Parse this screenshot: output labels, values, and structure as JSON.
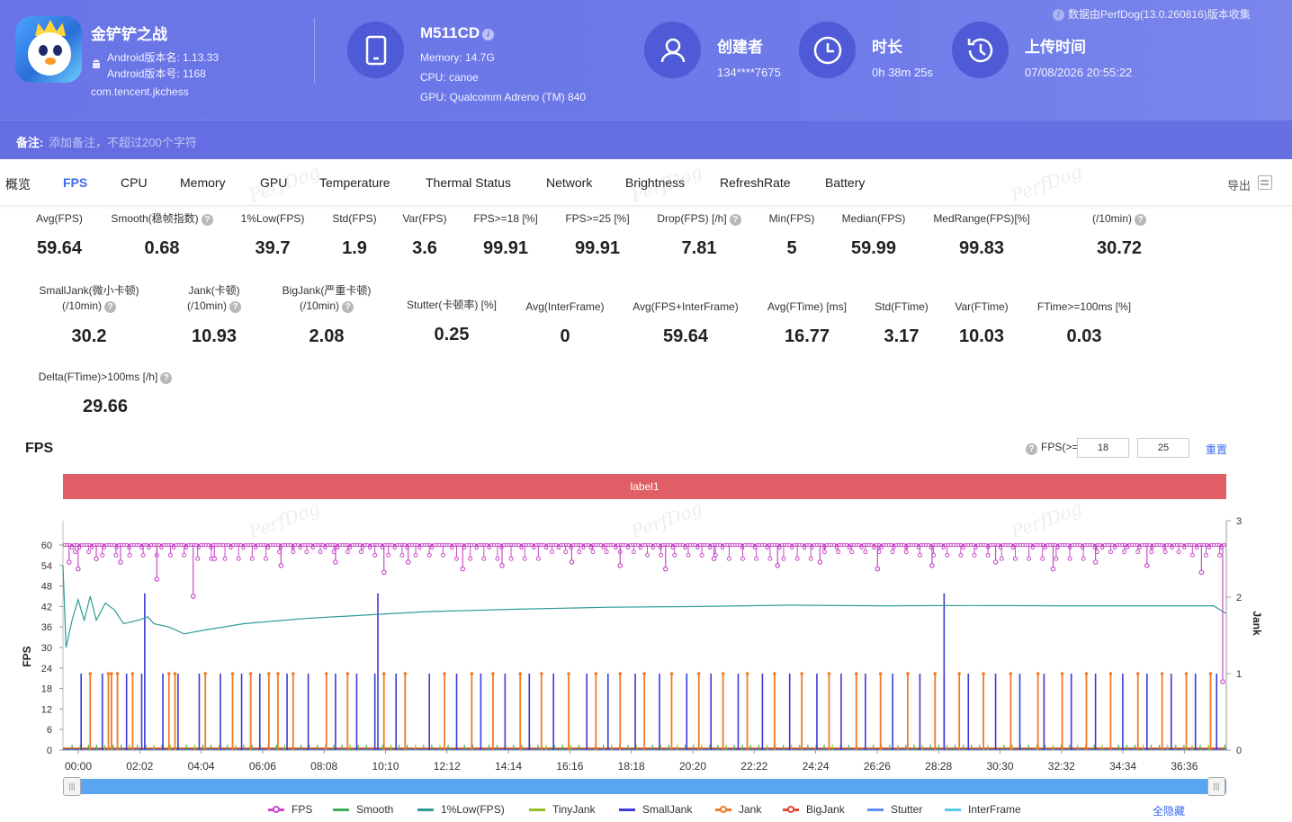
{
  "app": {
    "name": "金铲铲之战",
    "version_name": "Android版本名: 1.13.33",
    "version_code": "Android版本号: 1168",
    "package": "com.tencent.jkchess"
  },
  "device": {
    "model": "M511CD",
    "memory": "Memory: 14.7G",
    "cpu": "CPU: canoe",
    "gpu": "GPU: Qualcomm Adreno (TM) 840"
  },
  "creator": {
    "title": "创建者",
    "value": "134****7675"
  },
  "duration": {
    "title": "时长",
    "value": "0h 38m 25s"
  },
  "upload": {
    "title": "上传时间",
    "value": "07/08/2026 20:55:22"
  },
  "source_note": "数据由PerfDog(13.0.260816)版本收集",
  "remark": {
    "label": "备注:",
    "placeholder": "添加备注，不超过200个字符"
  },
  "tabs": [
    "概览",
    "FPS",
    "CPU",
    "Memory",
    "GPU",
    "Temperature",
    "Thermal Status",
    "Network",
    "Brightness",
    "RefreshRate",
    "Battery"
  ],
  "active_tab": "FPS",
  "export_label": "导出",
  "watermark": "PerfDog",
  "metrics_row1": [
    {
      "label": "Avg(FPS)",
      "value": "59.64"
    },
    {
      "label": "Smooth(稳帧指数)",
      "value": "0.68"
    },
    {
      "label": "1%Low(FPS)",
      "value": "39.7"
    },
    {
      "label": "Std(FPS)",
      "value": "1.9"
    },
    {
      "label": "Var(FPS)",
      "value": "3.6"
    },
    {
      "label": "FPS>=18 [%]",
      "value": "99.91"
    },
    {
      "label": "FPS>=25 [%]",
      "value": "99.91"
    },
    {
      "label": "Drop(FPS) [/h]",
      "value": "7.81"
    },
    {
      "label": "Min(FPS)",
      "value": "5"
    },
    {
      "label": "Median(FPS)",
      "value": "59.99"
    },
    {
      "label": "MedRange(FPS)[%]",
      "value": "99.83"
    },
    {
      "label": "(/10min)",
      "value": "30.72"
    }
  ],
  "metrics_row2": [
    {
      "label1": "SmallJank(微小卡顿)",
      "label2": "(/10min)",
      "value": "30.2"
    },
    {
      "label1": "Jank(卡顿)",
      "label2": "(/10min)",
      "value": "10.93"
    },
    {
      "label1": "BigJank(严重卡顿)",
      "label2": "(/10min)",
      "value": "2.08"
    },
    {
      "label1": "Stutter(卡顿率) [%]",
      "value": "0.25"
    },
    {
      "label1": "Avg(InterFrame)",
      "value": "0"
    },
    {
      "label1": "Avg(FPS+InterFrame)",
      "value": "59.64"
    },
    {
      "label1": "Avg(FTime) [ms]",
      "value": "16.77"
    },
    {
      "label1": "Std(FTime)",
      "value": "3.17"
    },
    {
      "label1": "Var(FTime)",
      "value": "10.03"
    },
    {
      "label1": "FTime>=100ms [%]",
      "value": "0.03"
    }
  ],
  "metrics_row3": [
    {
      "label": "Delta(FTime)>100ms [/h]",
      "value": "29.66"
    }
  ],
  "chart_controls": {
    "title": "FPS",
    "threshold_label": "FPS(>=)",
    "threshold1": "18",
    "threshold2": "25",
    "reset_label": "重置",
    "band_label": "label1",
    "hide_all_label": "全隐藏"
  },
  "chart_data": {
    "type": "line",
    "title": "FPS",
    "ylabel": "FPS",
    "y2label": "Jank",
    "ylim": [
      0,
      60
    ],
    "y2lim": [
      0,
      3
    ],
    "yticks": [
      "0",
      "6",
      "12",
      "18",
      "24",
      "30",
      "36",
      "42",
      "48",
      "54",
      "60"
    ],
    "y2ticks": [
      "0",
      "1",
      "2",
      "3"
    ],
    "xticks": [
      "00:00",
      "02:02",
      "04:04",
      "06:06",
      "08:08",
      "10:10",
      "12:12",
      "14:14",
      "16:16",
      "18:18",
      "20:20",
      "22:22",
      "24:24",
      "26:26",
      "28:28",
      "30:30",
      "32:32",
      "34:34",
      "36:36"
    ],
    "x_range_minutes": [
      0,
      38.42
    ],
    "series": [
      {
        "name": "FPS",
        "color": "#c94bc9",
        "baseline": 60,
        "dips": [
          [
            0.2,
            55
          ],
          [
            0.5,
            53
          ],
          [
            1.1,
            56
          ],
          [
            1.9,
            55
          ],
          [
            3.1,
            50
          ],
          [
            4.3,
            45
          ],
          [
            5.0,
            56
          ],
          [
            7.2,
            54
          ],
          [
            9.0,
            55
          ],
          [
            10.6,
            52
          ],
          [
            11.4,
            55
          ],
          [
            13.2,
            53
          ],
          [
            14.5,
            54
          ],
          [
            16.8,
            55
          ],
          [
            18.4,
            54
          ],
          [
            19.9,
            53
          ],
          [
            21.5,
            56
          ],
          [
            23.6,
            54
          ],
          [
            25.0,
            55
          ],
          [
            26.9,
            53
          ],
          [
            28.7,
            54
          ],
          [
            30.8,
            55
          ],
          [
            32.7,
            53
          ],
          [
            34.1,
            55
          ],
          [
            35.8,
            54
          ],
          [
            37.6,
            52
          ],
          [
            38.3,
            20
          ]
        ]
      },
      {
        "name": "Smooth",
        "color": "#3fae5a"
      },
      {
        "name": "1%Low(FPS)",
        "color": "#2e9b96",
        "points": [
          [
            0,
            54
          ],
          [
            0.1,
            30
          ],
          [
            0.3,
            38
          ],
          [
            0.5,
            44
          ],
          [
            0.7,
            38
          ],
          [
            0.9,
            45
          ],
          [
            1.1,
            38
          ],
          [
            1.4,
            43
          ],
          [
            1.7,
            41
          ],
          [
            2.0,
            37
          ],
          [
            2.5,
            38
          ],
          [
            2.8,
            39
          ],
          [
            3.0,
            37
          ],
          [
            3.5,
            36
          ],
          [
            4.0,
            34
          ],
          [
            4.6,
            35
          ],
          [
            6.0,
            37
          ],
          [
            8.0,
            38.5
          ],
          [
            10.0,
            39.5
          ],
          [
            12.0,
            40.5
          ],
          [
            15.0,
            41.2
          ],
          [
            18.0,
            41.8
          ],
          [
            21.0,
            42
          ],
          [
            24.0,
            42.4
          ],
          [
            27.0,
            42.2
          ],
          [
            30.0,
            42.3
          ],
          [
            33.0,
            42.2
          ],
          [
            36.0,
            42.2
          ],
          [
            38.0,
            42.2
          ],
          [
            38.4,
            40
          ]
        ]
      },
      {
        "name": "TinyJank",
        "color": "#8fc31f"
      },
      {
        "name": "SmallJank",
        "color": "#3b3bd6",
        "spikes": [
          0.6,
          1.3,
          2.1,
          2.6,
          3.3,
          3.8,
          4.5,
          5.2,
          5.9,
          6.5,
          7.4,
          8.1,
          9.0,
          9.7,
          10.3,
          11.0,
          12.1,
          13.0,
          13.8,
          14.6,
          15.4,
          16.2,
          17.3,
          18.0,
          18.9,
          19.7,
          20.6,
          21.4,
          22.3,
          23.1,
          24.0,
          24.9,
          25.7,
          26.5,
          27.4,
          28.3,
          29.1,
          29.9,
          30.8,
          31.6,
          32.4,
          33.3,
          34.1,
          35.0,
          35.8,
          36.6,
          37.4,
          38.1
        ],
        "big_spikes": [
          2.7,
          10.4,
          29.1
        ]
      },
      {
        "name": "Jank",
        "color": "#f07b27",
        "spikes": [
          0.9,
          1.5,
          1.6,
          1.8,
          2.3,
          3.5,
          3.7,
          4.7,
          5.6,
          6.2,
          6.8,
          7.1,
          7.6,
          8.7,
          9.4,
          10.6,
          11.3,
          12.6,
          13.5,
          14.2,
          15.1,
          15.8,
          16.7,
          17.6,
          18.4,
          19.2,
          20.1,
          21.0,
          21.8,
          22.6,
          23.5,
          24.4,
          25.3,
          26.2,
          27.0,
          27.9,
          28.8,
          29.6,
          30.4,
          31.3,
          32.2,
          33.0,
          33.8,
          34.6,
          35.5,
          36.3,
          37.1,
          37.9
        ]
      },
      {
        "name": "BigJank",
        "color": "#e04a3a"
      },
      {
        "name": "Stutter",
        "color": "#5b8ff5"
      },
      {
        "name": "InterFrame",
        "color": "#59c6ea"
      }
    ]
  }
}
